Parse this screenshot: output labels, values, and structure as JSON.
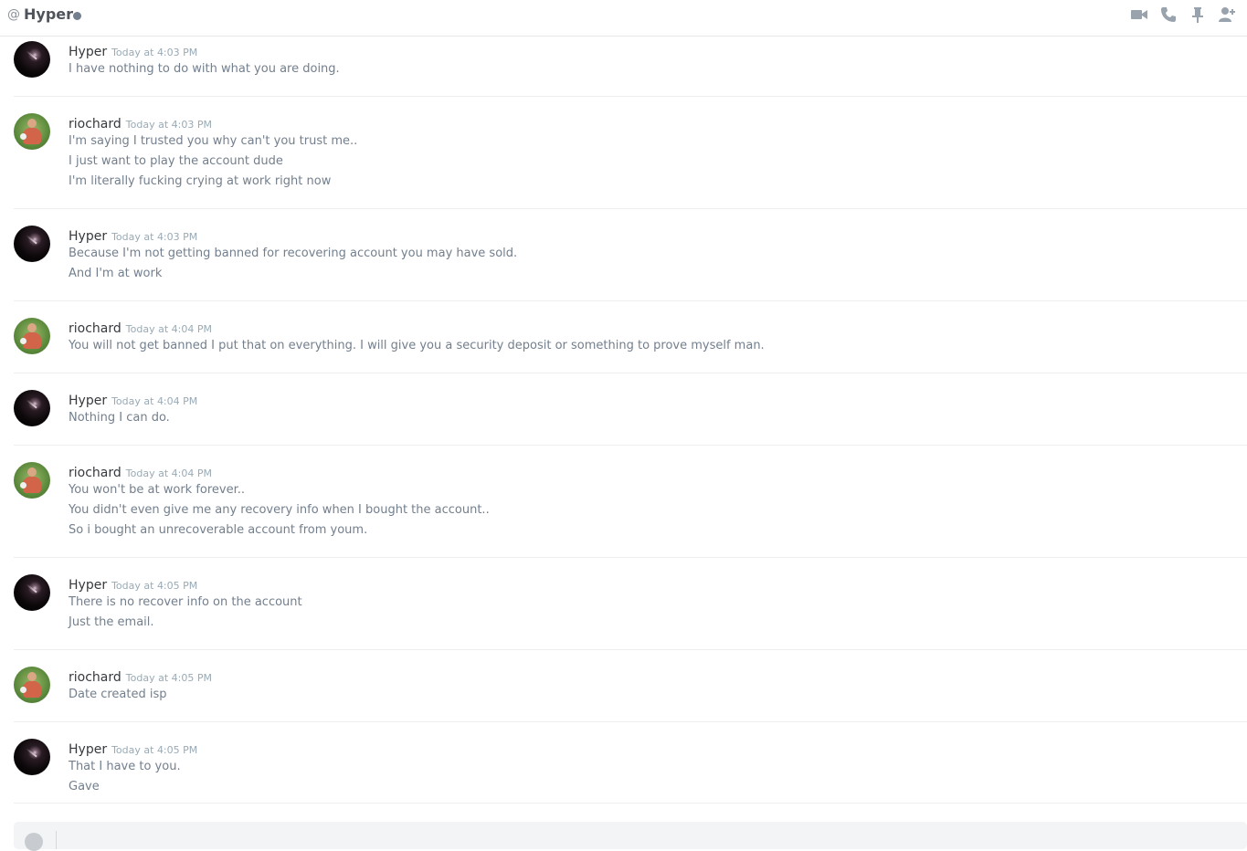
{
  "header": {
    "at_symbol": "@",
    "title": "Hyper",
    "status": "offline",
    "icons": [
      "video-call-icon",
      "voice-call-icon",
      "pin-icon",
      "add-friend-icon"
    ]
  },
  "messages": [
    {
      "author": "Hyper",
      "avatar": "hyper",
      "timestamp": "Today at 4:03 PM",
      "lines": [
        "I have nothing to do with what you are doing."
      ]
    },
    {
      "author": "riochard",
      "avatar": "rio",
      "timestamp": "Today at 4:03 PM",
      "lines": [
        "I'm saying I trusted you why can't you trust me..",
        "I just want to play the account dude",
        "I'm literally fucking crying at work right now"
      ]
    },
    {
      "author": "Hyper",
      "avatar": "hyper",
      "timestamp": "Today at 4:03 PM",
      "lines": [
        "Because I'm not getting banned for recovering account you may have sold.",
        "And I'm at work"
      ]
    },
    {
      "author": "riochard",
      "avatar": "rio",
      "timestamp": "Today at 4:04 PM",
      "lines": [
        "You will not get banned I put that on everything. I will give you a security deposit or something to prove myself man."
      ]
    },
    {
      "author": "Hyper",
      "avatar": "hyper",
      "timestamp": "Today at 4:04 PM",
      "lines": [
        "Nothing I can do."
      ]
    },
    {
      "author": "riochard",
      "avatar": "rio",
      "timestamp": "Today at 4:04 PM",
      "lines": [
        "You won't be at work forever..",
        "You didn't even give me any recovery info when I bought the account..",
        "So i bought an unrecoverable account from youm."
      ]
    },
    {
      "author": "Hyper",
      "avatar": "hyper",
      "timestamp": "Today at 4:05 PM",
      "lines": [
        "There is no recover info on the account",
        "Just the email."
      ]
    },
    {
      "author": "riochard",
      "avatar": "rio",
      "timestamp": "Today at 4:05 PM",
      "lines": [
        "Date created isp"
      ]
    },
    {
      "author": "Hyper",
      "avatar": "hyper",
      "timestamp": "Today at 4:05 PM",
      "lines": [
        "That I have to you.",
        "Gave"
      ]
    }
  ]
}
